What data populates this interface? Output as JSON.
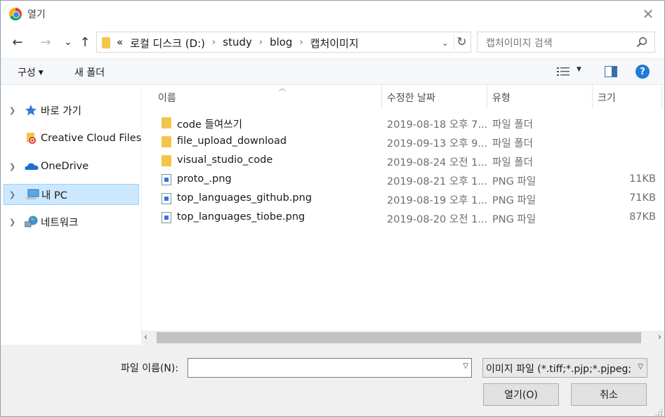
{
  "window": {
    "title": "열기",
    "close_glyph": "✕"
  },
  "nav": {
    "back_glyph": "←",
    "forward_glyph": "→",
    "recent_glyph": "⌄",
    "up_glyph": "↑"
  },
  "address": {
    "overflow": "«",
    "crumbs": [
      "로컬 디스크 (D:)",
      "study",
      "blog",
      "캡처이미지"
    ],
    "separator": "›",
    "dropdown_glyph": "⌄",
    "refresh_glyph": "↻"
  },
  "search": {
    "placeholder": "캡처이미지 검색"
  },
  "toolbar": {
    "organize_label": "구성",
    "new_folder_label": "새 폴더",
    "help_glyph": "?"
  },
  "sidebar": {
    "items": [
      {
        "label": "바로 가기",
        "icon": "star-icon",
        "has_chevron": true
      },
      {
        "label": "Creative Cloud Files",
        "icon": "creative-cloud-icon",
        "has_chevron": false
      },
      {
        "label": "OneDrive",
        "icon": "onedrive-icon",
        "has_chevron": true
      },
      {
        "label": "내 PC",
        "icon": "pc-icon",
        "has_chevron": true,
        "selected": true
      },
      {
        "label": "네트워크",
        "icon": "network-icon",
        "has_chevron": true
      }
    ]
  },
  "columns": {
    "name": "이름",
    "date": "수정한 날짜",
    "type": "유형",
    "size": "크기"
  },
  "files": [
    {
      "name": "code 들여쓰기",
      "date": "2019-08-18 오후 7...",
      "type": "파일 폴더",
      "size": "",
      "kind": "folder"
    },
    {
      "name": "file_upload_download",
      "date": "2019-09-13 오후 9...",
      "type": "파일 폴더",
      "size": "",
      "kind": "folder"
    },
    {
      "name": "visual_studio_code",
      "date": "2019-08-24 오전 1...",
      "type": "파일 폴더",
      "size": "",
      "kind": "folder"
    },
    {
      "name": "proto_.png",
      "date": "2019-08-21 오후 1...",
      "type": "PNG 파일",
      "size": "11KB",
      "kind": "png"
    },
    {
      "name": "top_languages_github.png",
      "date": "2019-08-19 오후 1...",
      "type": "PNG 파일",
      "size": "71KB",
      "kind": "png"
    },
    {
      "name": "top_languages_tiobe.png",
      "date": "2019-08-20 오전 1...",
      "type": "PNG 파일",
      "size": "87KB",
      "kind": "png"
    }
  ],
  "scrollbar": {
    "left_glyph": "‹",
    "right_glyph": "›"
  },
  "footer": {
    "filename_label": "파일 이름(N):",
    "filename_value": "",
    "filter_value": "이미지 파일 (*.tiff;*.pjp;*.pjpeg;",
    "open_label": "열기(O)",
    "cancel_label": "취소"
  },
  "colors": {
    "selection_bg": "#cce8ff",
    "folder": "#f3c64b",
    "help_blue": "#1e7bd8"
  }
}
